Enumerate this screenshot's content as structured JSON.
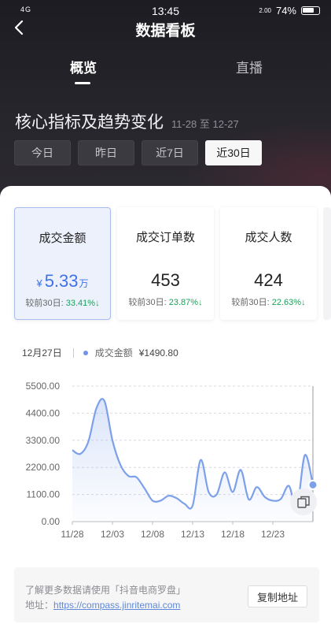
{
  "status_bar": {
    "left": "4G",
    "time": "13:45",
    "net_speed": "2.00",
    "battery": "74%"
  },
  "header": {
    "title": "数据看板"
  },
  "tabs": [
    {
      "label": "概览",
      "active": true
    },
    {
      "label": "直播",
      "active": false
    }
  ],
  "section": {
    "title": "核心指标及趋势变化",
    "range": "11-28 至 12-27"
  },
  "ranges": [
    {
      "label": "今日",
      "active": false
    },
    {
      "label": "昨日",
      "active": false
    },
    {
      "label": "近7日",
      "active": false
    },
    {
      "label": "近30日",
      "active": true
    }
  ],
  "metrics": [
    {
      "label": "成交金额",
      "currency": "¥",
      "value": "5.33",
      "unit": "万",
      "compare_label": "较前30日:",
      "compare_pct": "33.41%",
      "active": true
    },
    {
      "label": "成交订单数",
      "currency": "",
      "value": "453",
      "unit": "",
      "compare_label": "较前30日:",
      "compare_pct": "23.87%",
      "active": false
    },
    {
      "label": "成交人数",
      "currency": "",
      "value": "424",
      "unit": "",
      "compare_label": "较前30日:",
      "compare_pct": "22.63%",
      "active": false
    }
  ],
  "tooltip": {
    "date": "12月27日",
    "series": "成交金额",
    "value": "¥1490.80"
  },
  "chart_data": {
    "type": "area",
    "series": [
      {
        "name": "成交金额",
        "values": [
          2900,
          2750,
          3250,
          4600,
          4900,
          3300,
          2300,
          1850,
          1800,
          1350,
          850,
          850,
          1050,
          950,
          720,
          650,
          2500,
          1200,
          1100,
          2000,
          1200,
          2100,
          900,
          1400,
          1000,
          850,
          920,
          1450,
          600,
          2700,
          1490.8
        ]
      }
    ],
    "x_ticks": [
      "11/28",
      "12/03",
      "12/08",
      "12/13",
      "12/18",
      "12/23"
    ],
    "y_ticks": [
      "0.00",
      "1100.00",
      "2200.00",
      "3300.00",
      "4400.00",
      "5500.00"
    ],
    "ylim": [
      0,
      5500
    ],
    "grid": true,
    "color": "#7ca0ea"
  },
  "footer": {
    "line1": "了解更多数据请使用「抖音电商罗盘」",
    "address_label": "地址：",
    "address_url": "https://compass.jinritemai.com",
    "copy_label": "复制地址"
  }
}
